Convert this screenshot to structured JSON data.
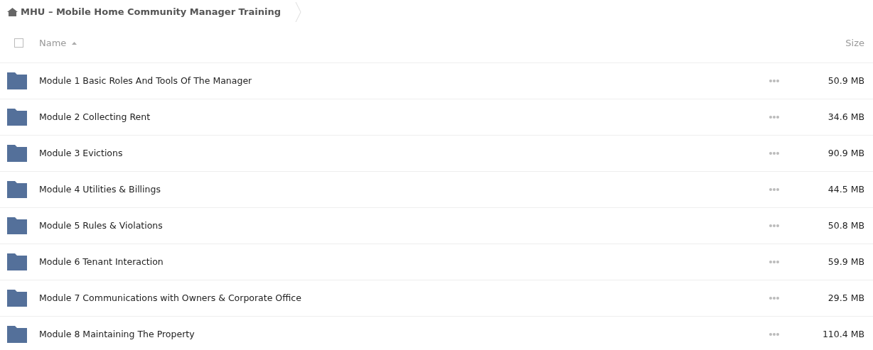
{
  "breadcrumb": {
    "title": "MHU – Mobile Home Community Manager Training"
  },
  "header": {
    "select_all": {
      "checked": false
    },
    "name_label": "Name",
    "size_label": "Size"
  },
  "files": [
    {
      "name": "Module 1 Basic Roles And Tools Of The Manager",
      "size": "50.9 MB"
    },
    {
      "name": "Module 2 Collecting Rent",
      "size": "34.6 MB"
    },
    {
      "name": "Module 3 Evictions",
      "size": "90.9 MB"
    },
    {
      "name": "Module 4 Utilities & Billings",
      "size": "44.5 MB"
    },
    {
      "name": "Module 5 Rules & Violations",
      "size": "50.8 MB"
    },
    {
      "name": "Module 6 Tenant Interaction",
      "size": "59.9 MB"
    },
    {
      "name": "Module 7 Communications with Owners & Corporate Office",
      "size": "29.5 MB"
    },
    {
      "name": "Module 8 Maintaining The Property",
      "size": "110.4 MB"
    }
  ]
}
